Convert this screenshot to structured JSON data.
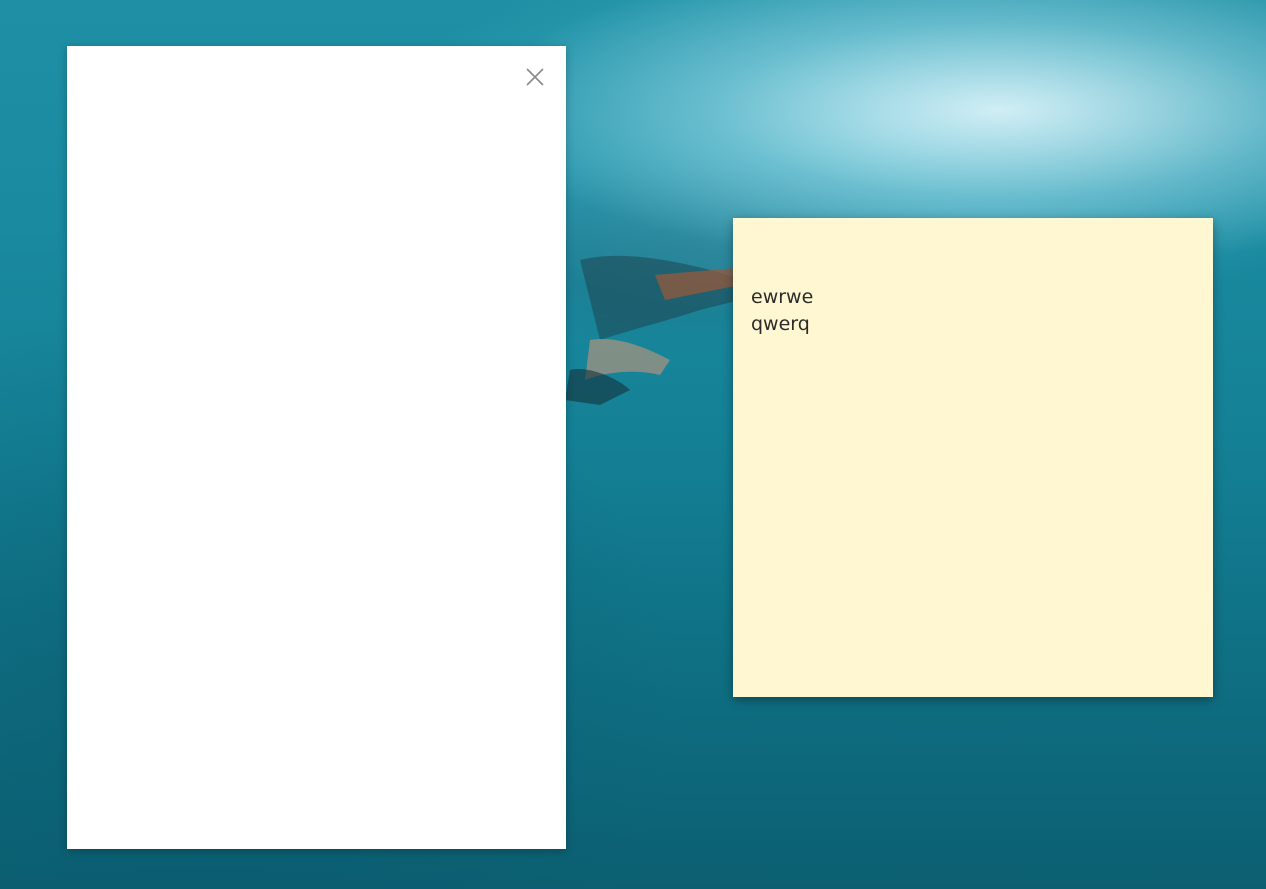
{
  "desktop": {
    "wallpaper_icon": "underwater-swimmer-image"
  },
  "left_panel": {
    "close_icon": "close-icon"
  },
  "sticky_note": {
    "background_color": "#fff7d1",
    "lines": [
      "ewrwe",
      "qwerq"
    ]
  }
}
